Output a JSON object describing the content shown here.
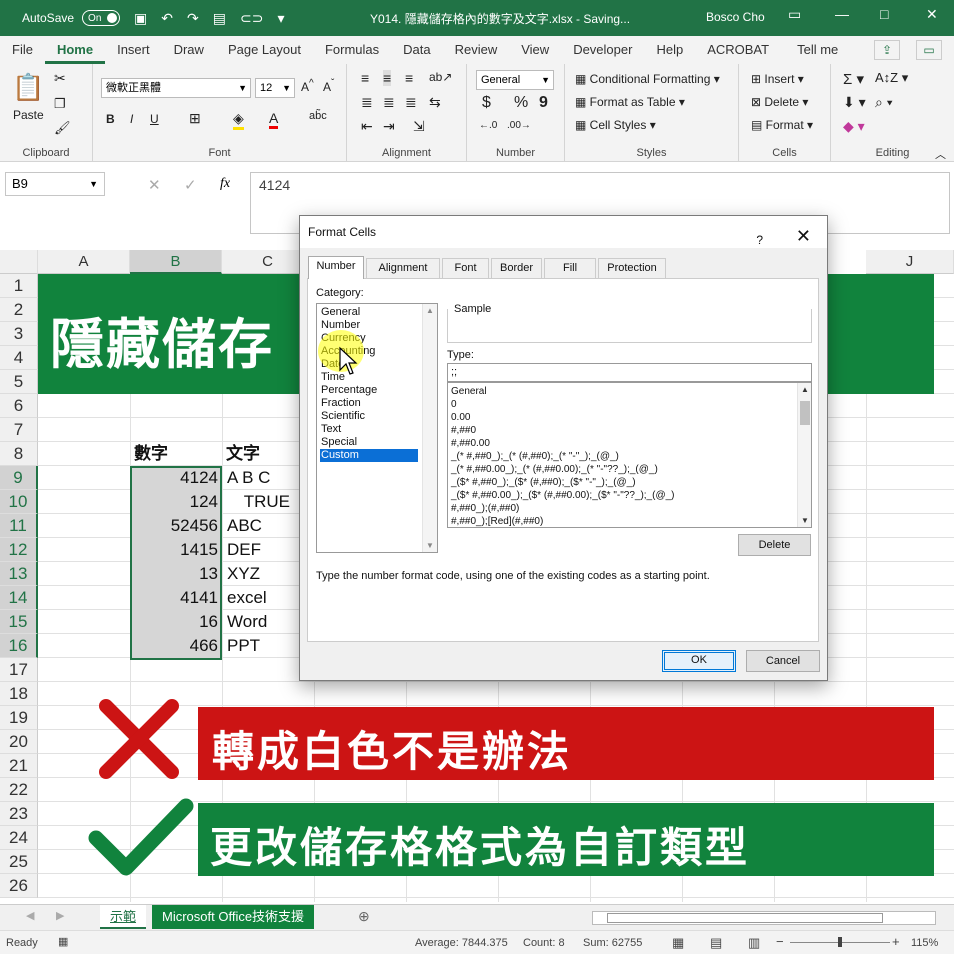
{
  "titlebar": {
    "autosave": "AutoSave",
    "toggle": "On",
    "doc_title": "Y014. 隱藏儲存格內的數字及文字.xlsx - Saving...",
    "user": "Bosco Cho"
  },
  "ribbon_tabs": [
    "File",
    "Home",
    "Insert",
    "Draw",
    "Page Layout",
    "Formulas",
    "Data",
    "Review",
    "View",
    "Developer",
    "Help",
    "ACROBAT",
    "Tell me"
  ],
  "ribbon": {
    "clipboard": {
      "label": "Clipboard",
      "paste": "Paste"
    },
    "font": {
      "label": "Font",
      "font_name": "微軟正黑體",
      "font_size": "12",
      "bold": "B",
      "italic": "I",
      "underline": "U"
    },
    "alignment": {
      "label": "Alignment"
    },
    "number": {
      "label": "Number",
      "format": "General",
      "currency": "$",
      "percent": "%",
      "comma": "9"
    },
    "styles": {
      "label": "Styles",
      "conditional": "Conditional Formatting",
      "table": "Format as Table",
      "cell_styles": "Cell Styles"
    },
    "cells": {
      "label": "Cells",
      "insert": "Insert",
      "delete": "Delete",
      "format": "Format"
    },
    "editing": {
      "label": "Editing"
    }
  },
  "formula_bar": {
    "name_box": "B9",
    "fx": "fx",
    "value": "4124"
  },
  "columns": [
    "A",
    "B",
    "C",
    "J"
  ],
  "rows": [
    "1",
    "2",
    "3",
    "4",
    "5",
    "6",
    "7",
    "8",
    "9",
    "10",
    "11",
    "12",
    "13",
    "14",
    "15",
    "16",
    "17",
    "18",
    "19",
    "20",
    "21",
    "22",
    "23",
    "24",
    "25",
    "26"
  ],
  "sheet": {
    "banner_title": "隱藏儲存",
    "col_b_header": "數字",
    "col_c_header": "文字",
    "numbers": [
      "4124",
      "124",
      "52456",
      "1415",
      "13",
      "4141",
      "16",
      "466"
    ],
    "texts": [
      "A B C",
      "TRUE",
      "ABC",
      "DEF",
      "XYZ",
      "excel",
      "Word",
      "PPT"
    ],
    "wrong_tip": "轉成白色不是辦法",
    "right_tip": "更改儲存格格式為自訂類型"
  },
  "sheet_tabs": [
    "示範",
    "Microsoft Office技術支援"
  ],
  "status": {
    "ready": "Ready",
    "average": "Average: 7844.375",
    "count": "Count: 8",
    "sum": "Sum: 62755",
    "zoom": "115%"
  },
  "dialog": {
    "title": "Format Cells",
    "help": "?",
    "tabs": [
      "Number",
      "Alignment",
      "Font",
      "Border",
      "Fill",
      "Protection"
    ],
    "category_label": "Category:",
    "categories": [
      "General",
      "Number",
      "Currency",
      "Accounting",
      "Date",
      "Time",
      "Percentage",
      "Fraction",
      "Scientific",
      "Text",
      "Special",
      "Custom"
    ],
    "selected_category": "Custom",
    "sample_label": "Sample",
    "type_label": "Type:",
    "type_value": ";;",
    "type_list": [
      "General",
      "0",
      "0.00",
      "#,##0",
      "#,##0.00",
      "_(* #,##0_);_(* (#,##0);_(* \"-\"_);_(@_)",
      "_(* #,##0.00_);_(* (#,##0.00);_(* \"-\"??_);_(@_)",
      "_($* #,##0_);_($* (#,##0);_($* \"-\"_);_(@_)",
      "_($* #,##0.00_);_($* (#,##0.00);_($* \"-\"??_);_(@_)",
      "#,##0_);(#,##0)",
      "#,##0_);[Red](#,##0)"
    ],
    "delete": "Delete",
    "hint": "Type the number format code, using one of the existing codes as a starting point.",
    "ok": "OK",
    "cancel": "Cancel"
  },
  "colors": {
    "excel_green": "#217346",
    "banner_green": "#11833d",
    "red": "#cc1414",
    "selection_blue": "#0b6fd6"
  }
}
